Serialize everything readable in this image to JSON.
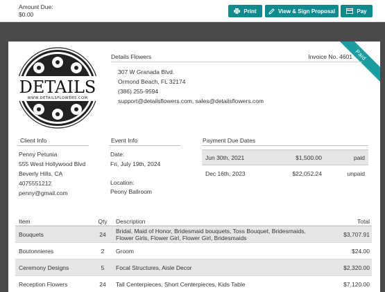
{
  "topbar": {
    "amount_label": "Amount Due:",
    "amount_value": "$0.00",
    "print_label": "Print",
    "view_label": "View & Sign Proposal",
    "pay_label": "Pay",
    "accent": "#0f8a8e"
  },
  "invoice": {
    "status_ribbon": "Paid",
    "business_name": "Details Flowers",
    "invoice_no": "Invoice No. 4601",
    "logo_text": "DETAILS",
    "logo_url_text": "WWW.DETAILSFLOWERS.COM",
    "address": [
      "307 W Granada Blvd.",
      "Ormond Beach, FL 32174",
      "(386) 255-9594",
      "support@detailsflowers.com, sales@detailsflowers.com"
    ]
  },
  "client": {
    "label": "Client Info",
    "lines": [
      "Penny Petunia",
      "555 West Hollywood Blvd",
      "Beverly Hills, CA",
      "4075551212",
      "penny@gmail.com"
    ]
  },
  "event": {
    "label": "Event Info",
    "date_label": "Date:",
    "date": "Fri, July 19th, 2024",
    "location_label": "Location:",
    "location": "Peony Ballroom"
  },
  "payments": {
    "label": "Payment Due Dates",
    "rows": [
      {
        "date": "Jun 30th, 2021",
        "amount": "$1,500.00",
        "status": "paid"
      },
      {
        "date": "Dec 16th, 2023",
        "amount": "$22,052.24",
        "status": "unpaid"
      }
    ]
  },
  "items": {
    "headers": {
      "item": "Item",
      "qty": "Qty",
      "desc": "Description",
      "total": "Total"
    },
    "rows": [
      {
        "item": "Bouquets",
        "qty": "24",
        "desc": "Bridal, Maid of Honor, Bridesmaid bouquets, Toss Bouquet, Bridesmaids, Flower Girls, Flower Girl, Flower Girl, Bridesmaids",
        "total": "$3,707.91"
      },
      {
        "item": "Boutonnieres",
        "qty": "2",
        "desc": "Groom",
        "total": "$24.00"
      },
      {
        "item": "Ceremony Designs",
        "qty": "5",
        "desc": "Focal Structures, Aisle Decor",
        "total": "$2,320.00"
      },
      {
        "item": "Reception Flowers",
        "qty": "24",
        "desc": "Tall Centerpieces, Short Centerpieces, Kids Table",
        "total": "$7,120.00"
      }
    ]
  }
}
